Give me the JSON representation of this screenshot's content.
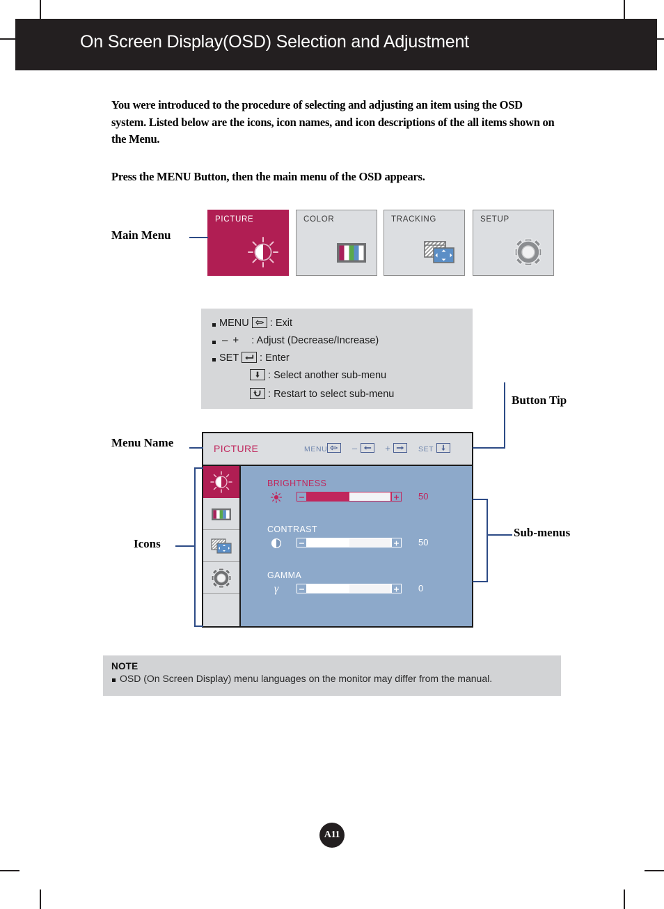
{
  "header": {
    "title": "On Screen Display(OSD) Selection and Adjustment"
  },
  "intro": {
    "paragraph1": "You were introduced to the procedure of selecting and adjusting an item using the OSD system.  Listed below are the icons, icon names, and icon descriptions of the all items shown on the Menu.",
    "paragraph2": "Press the MENU Button, then the main menu of the OSD appears."
  },
  "annotations": {
    "main_menu": "Main Menu",
    "button_tip": "Button Tip",
    "menu_name": "Menu Name",
    "icons": "Icons",
    "sub_menus": "Sub-menus"
  },
  "main_menu": {
    "tabs": [
      {
        "label": "PICTURE",
        "icon": "brightness-sun-icon",
        "active": true
      },
      {
        "label": "COLOR",
        "icon": "color-bars-icon",
        "active": false
      },
      {
        "label": "TRACKING",
        "icon": "tracking-arrows-icon",
        "active": false
      },
      {
        "label": "SETUP",
        "icon": "gear-icon",
        "active": false
      }
    ],
    "active_color": "#b01e53",
    "inactive_color": "#dcdee1"
  },
  "button_tip": {
    "lines": [
      {
        "prefix": "MENU",
        "key_icon": "menu-exit-icon",
        "suffix": ": Exit",
        "bullet": true,
        "indent": 0
      },
      {
        "prefix": "",
        "key_icon": "minus-plus-icon",
        "suffix": ": Adjust (Decrease/Increase)",
        "bullet": true,
        "indent": 0
      },
      {
        "prefix": "SET",
        "key_icon": "enter-return-icon",
        "suffix": ": Enter",
        "bullet": true,
        "indent": 0
      },
      {
        "prefix": "",
        "key_icon": "arrow-down-icon",
        "suffix": ": Select another sub-menu",
        "bullet": false,
        "indent": 1
      },
      {
        "prefix": "",
        "key_icon": "restart-loop-icon",
        "suffix": ": Restart to select sub-menu",
        "bullet": false,
        "indent": 1
      }
    ],
    "minus_symbol": "–",
    "plus_symbol": "+"
  },
  "osd": {
    "menu_name": "PICTURE",
    "hints": [
      {
        "label": "MENU",
        "icon": "menu-exit-icon"
      },
      {
        "label": "–",
        "icon": "arrow-left-icon"
      },
      {
        "label": "+",
        "icon": "arrow-right-icon"
      },
      {
        "label": "SET",
        "icon": "arrow-down-icon"
      }
    ],
    "sidebar_icons": [
      {
        "name": "brightness-sun-icon",
        "selected": true
      },
      {
        "name": "color-bars-icon",
        "selected": false
      },
      {
        "name": "tracking-arrows-icon",
        "selected": false
      },
      {
        "name": "gear-icon",
        "selected": false
      },
      {
        "name": "blank-icon",
        "selected": false
      }
    ],
    "submenus": [
      {
        "name": "BRIGHTNESS",
        "icon": "sun-icon",
        "value": "50",
        "percent": 50,
        "highlight": true
      },
      {
        "name": "CONTRAST",
        "icon": "half-circle-icon",
        "value": "50",
        "percent": 50,
        "highlight": false
      },
      {
        "name": "GAMMA",
        "icon": "gamma-icon",
        "value": "0",
        "percent": 50,
        "highlight": false
      }
    ],
    "highlight_color": "#c0265c",
    "normal_color": "#ffffff",
    "background_color": "#8da9ca",
    "header_background": "#dcdee1"
  },
  "note": {
    "title": "NOTE",
    "text": "OSD (On Screen Display) menu languages on the monitor may differ from the manual."
  },
  "footer": {
    "page_number": "A11"
  }
}
